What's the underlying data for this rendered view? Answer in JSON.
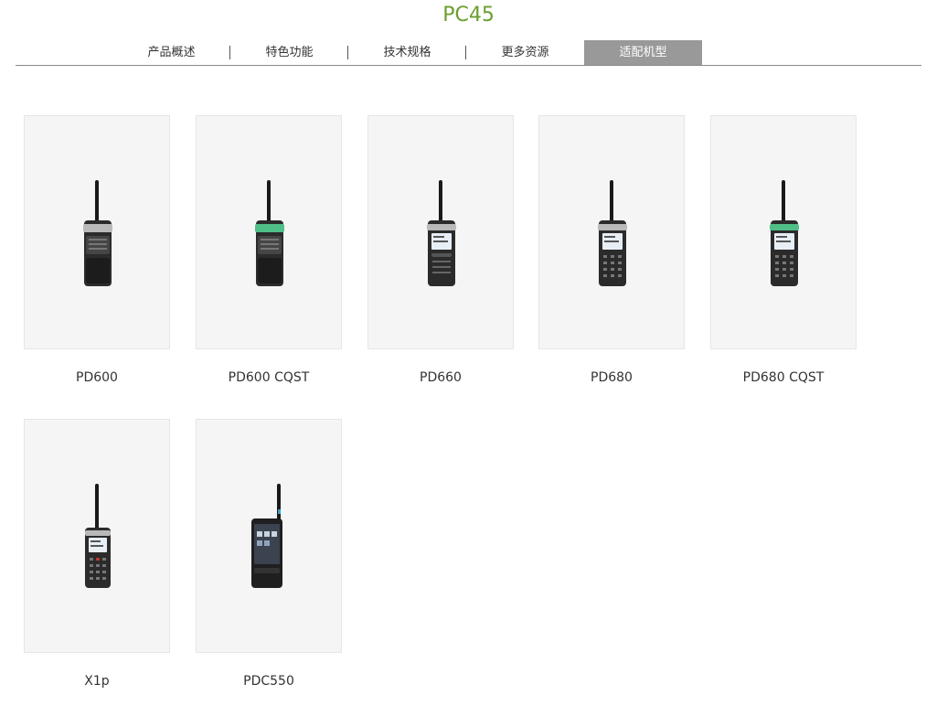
{
  "product": {
    "title": "PC45"
  },
  "tabs": [
    {
      "label": "产品概述",
      "active": false
    },
    {
      "label": "特色功能",
      "active": false
    },
    {
      "label": "技术规格",
      "active": false
    },
    {
      "label": "更多资源",
      "active": false
    },
    {
      "label": "适配机型",
      "active": true
    }
  ],
  "models": [
    {
      "name": "PD600",
      "icon": "radio-keyless-icon"
    },
    {
      "name": "PD600 CQST",
      "icon": "radio-keyless-green-icon"
    },
    {
      "name": "PD660",
      "icon": "radio-display-icon"
    },
    {
      "name": "PD680",
      "icon": "radio-keypad-icon"
    },
    {
      "name": "PD680 CQST",
      "icon": "radio-keypad-green-icon"
    },
    {
      "name": "X1p",
      "icon": "radio-compact-keypad-icon"
    },
    {
      "name": "PDC550",
      "icon": "radio-touchscreen-icon"
    }
  ],
  "colors": {
    "title": "#6b9e2f",
    "active_tab_bg": "#999999",
    "card_bg": "#f5f5f5"
  }
}
